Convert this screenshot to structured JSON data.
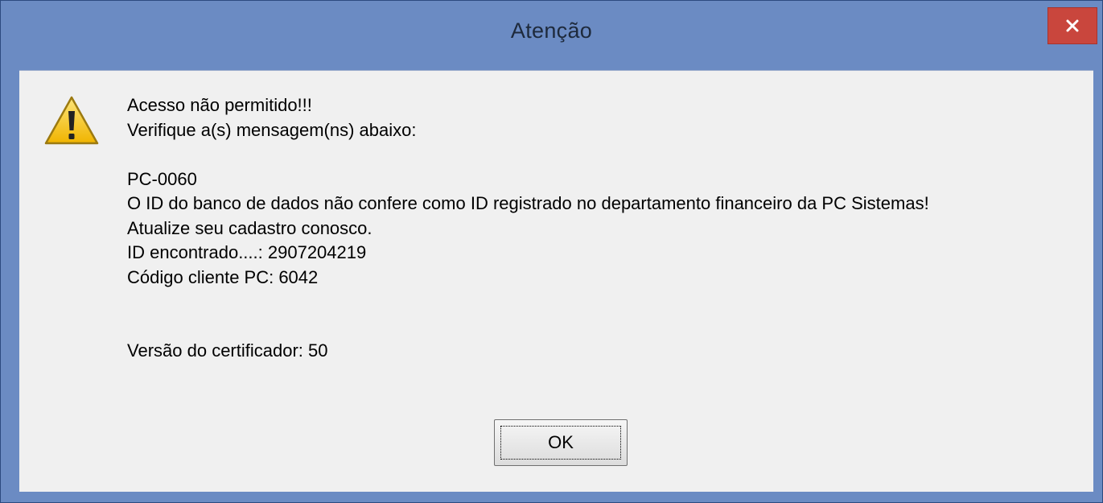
{
  "window": {
    "title": "Atenção"
  },
  "icons": {
    "warning": "warning-icon",
    "close": "close-icon"
  },
  "message": {
    "lines": [
      "Acesso não permitido!!!",
      "Verifique a(s) mensagem(ns) abaixo:",
      "",
      "PC-0060",
      "O ID do banco de dados não confere como ID registrado no departamento financeiro da PC Sistemas!",
      "Atualize seu cadastro conosco.",
      "ID encontrado....: 2907204219",
      "Código cliente PC: 6042",
      "",
      "",
      "Versão do certificador: 50"
    ]
  },
  "buttons": {
    "ok_label": "OK"
  },
  "colors": {
    "titlebar": "#6b8bc3",
    "close_button": "#c9463d",
    "client_background": "#f0f0f0",
    "warning_fill": "#f5c518"
  }
}
